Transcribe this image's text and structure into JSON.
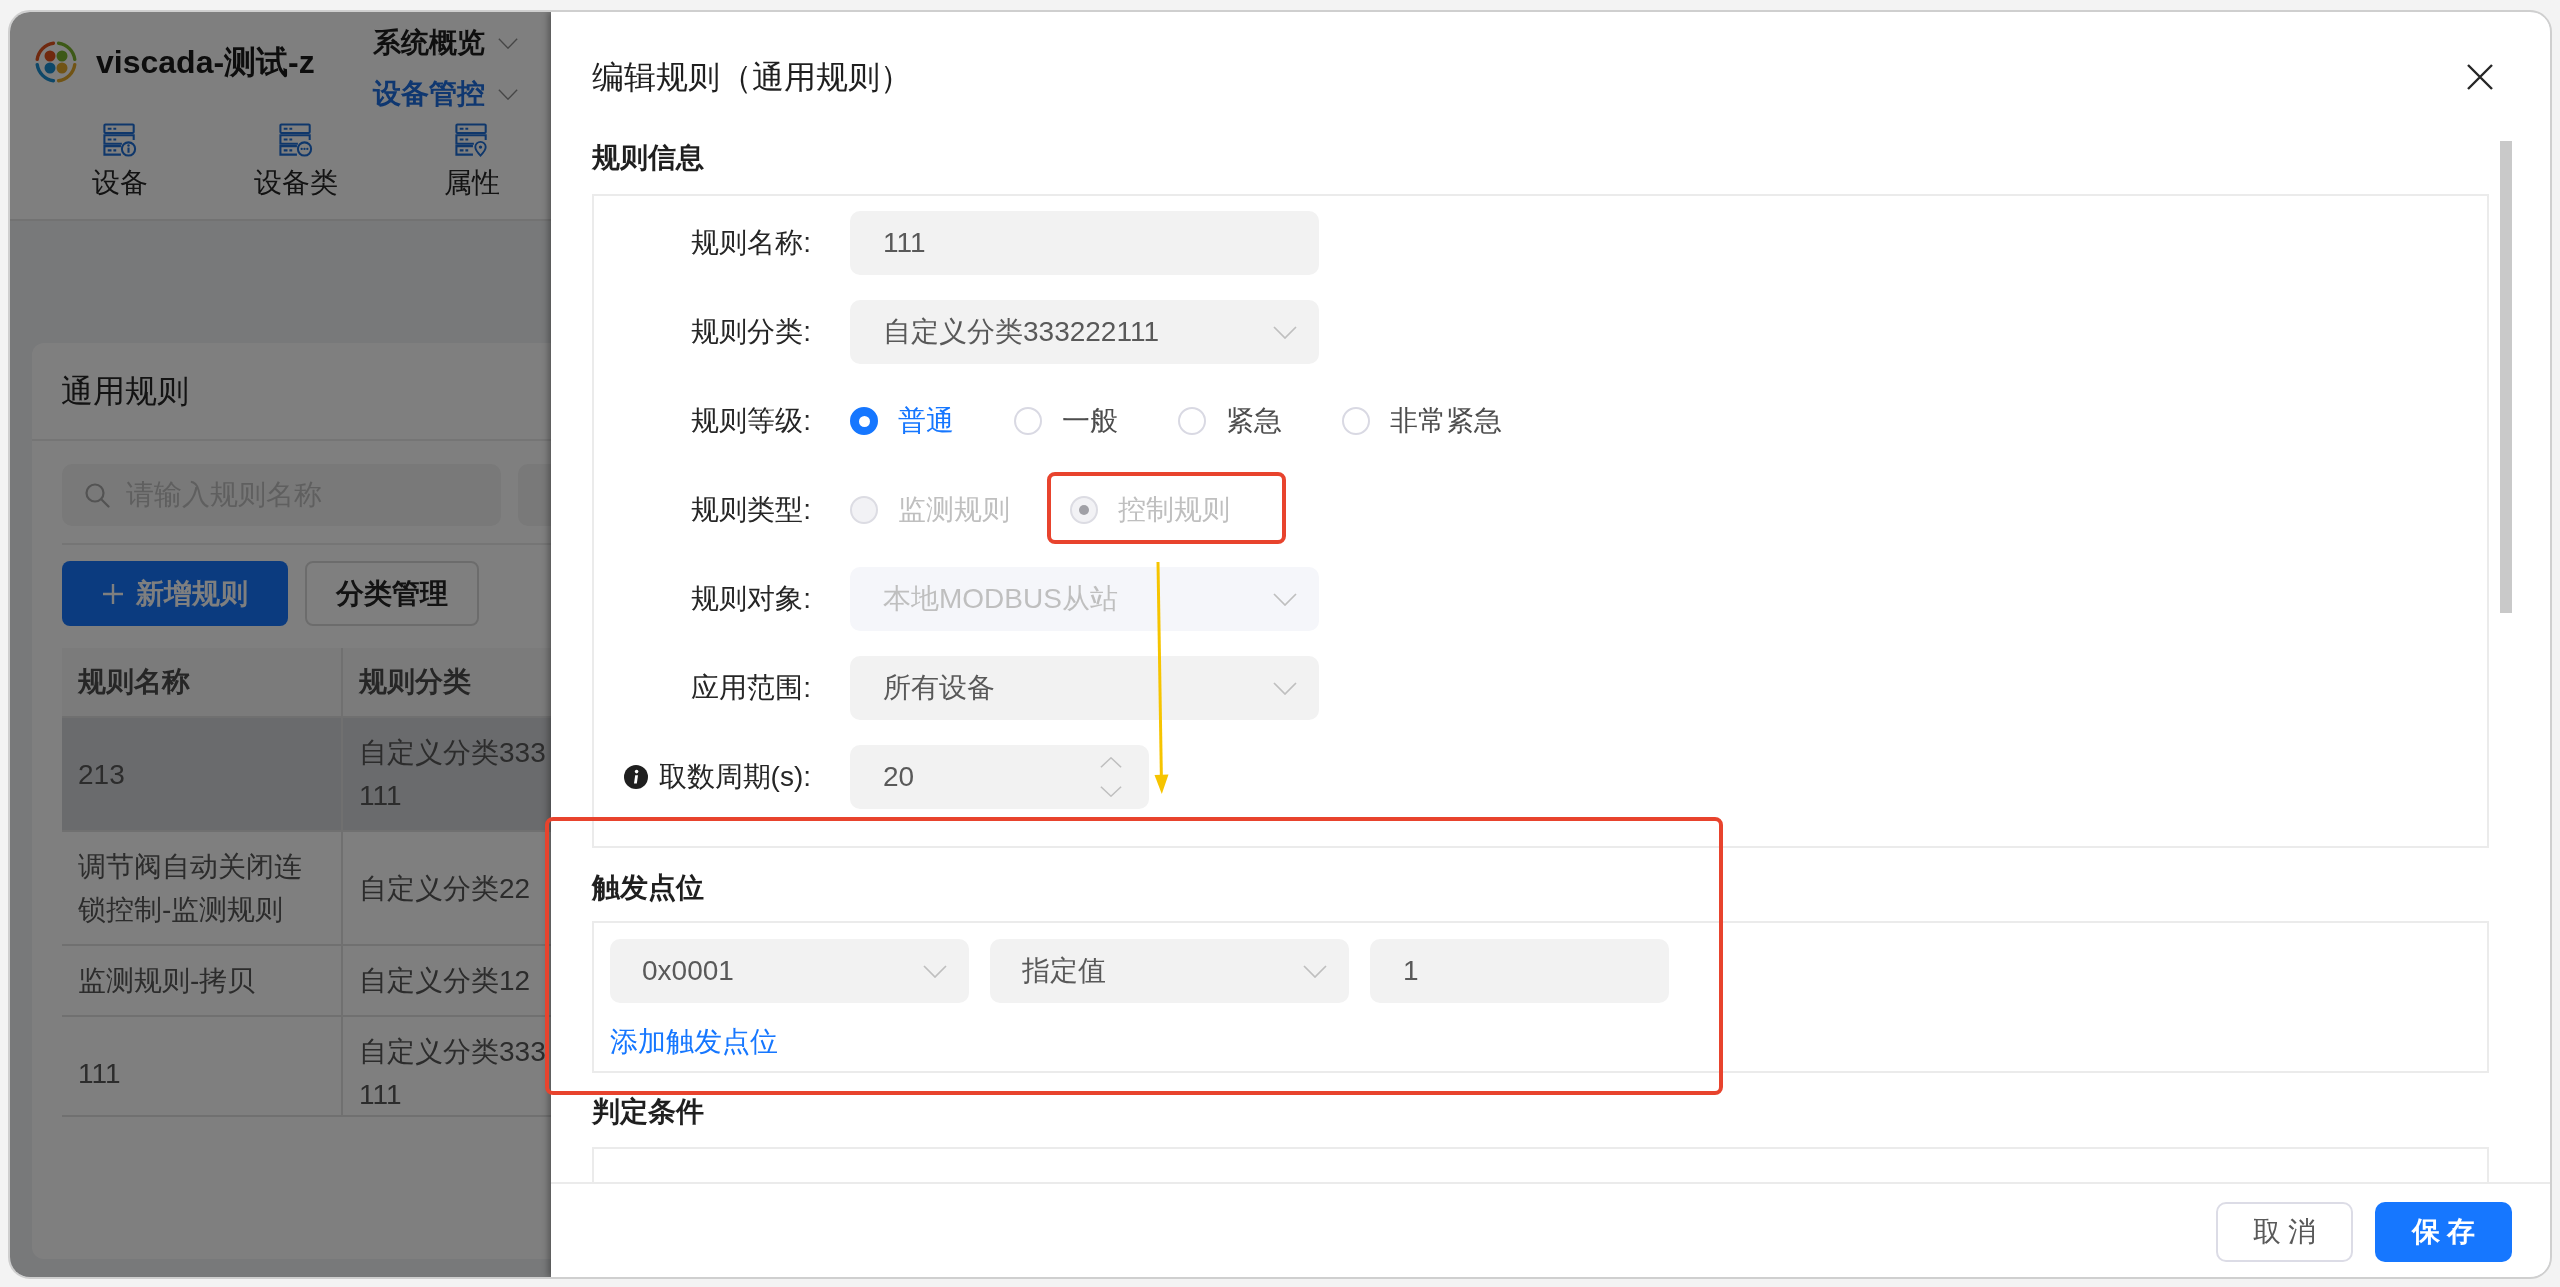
{
  "header": {
    "title": "viscada-测试-z",
    "menus": [
      {
        "label": "系统概览",
        "selected": false
      },
      {
        "label": "设备管控",
        "selected": true
      }
    ],
    "toolbar": [
      {
        "label": "设备",
        "kind": "info"
      },
      {
        "label": "设备类",
        "kind": "more"
      },
      {
        "label": "属性",
        "kind": "pin"
      }
    ]
  },
  "card": {
    "title": "通用规则",
    "filters": [
      {
        "kind": "search",
        "placeholder": "请输入规则名称"
      },
      {
        "kind": "select"
      }
    ],
    "buttons": [
      {
        "label": "新增规则",
        "kind": "add"
      },
      {
        "label": "分类管理",
        "kind": "default"
      }
    ],
    "table": {
      "columns": [
        "规则名称",
        "规则分类"
      ],
      "rows": [
        {
          "selected": true,
          "cells": [
            "213",
            "自定义分类333\n111"
          ]
        },
        {
          "selected": false,
          "cells": [
            "调节阀自动关闭连锁控制-监测规则",
            "自定义分类22"
          ]
        },
        {
          "selected": false,
          "cells": [
            "监测规则-拷贝",
            "自定义分类12"
          ]
        },
        {
          "selected": false,
          "cells": [
            "111",
            "自定义分类333\n111"
          ]
        }
      ]
    }
  },
  "drawer": {
    "title": "编辑规则（通用规则）",
    "sections": [
      {
        "kind": "form",
        "title": "规则信息",
        "fields": [
          {
            "kind": "input",
            "label": "规则名称:",
            "value": "111",
            "disabled": false,
            "tip": false
          },
          {
            "kind": "select",
            "label": "规则分类:",
            "value": "自定义分类333222111",
            "disabled": false,
            "tip": false
          },
          {
            "kind": "radio",
            "label": "规则等级:",
            "disabled": false,
            "tip": false,
            "options": [
              {
                "label": "普通",
                "selected": true
              },
              {
                "label": "一般",
                "selected": false
              },
              {
                "label": "紧急",
                "selected": false
              },
              {
                "label": "非常紧急",
                "selected": false
              }
            ]
          },
          {
            "kind": "radio",
            "label": "规则类型:",
            "disabled": true,
            "tip": false,
            "options": [
              {
                "label": "监测规则",
                "selected": false
              },
              {
                "label": "控制规则",
                "selected": true
              }
            ]
          },
          {
            "kind": "select",
            "label": "规则对象:",
            "value": "本地MODBUS从站",
            "disabled": true,
            "tip": false
          },
          {
            "kind": "select",
            "label": "应用范围:",
            "value": "所有设备",
            "disabled": false,
            "tip": false
          },
          {
            "kind": "number",
            "label": "取数周期(s):",
            "value": "20",
            "disabled": false,
            "tip": true
          }
        ]
      },
      {
        "kind": "trigger",
        "title": "触发点位",
        "fields": [
          {
            "kind": "select",
            "value": "0x0001"
          },
          {
            "kind": "select",
            "value": "指定值"
          },
          {
            "kind": "input",
            "value": "1"
          }
        ],
        "link": "添加触发点位"
      },
      {
        "kind": "conditions",
        "title": "判定条件"
      }
    ],
    "buttons": [
      {
        "label": "取 消",
        "kind": "default"
      },
      {
        "label": "保 存",
        "kind": "primary"
      }
    ]
  },
  "annotations": [
    {
      "kind": "box",
      "color": "#e8432d"
    },
    {
      "kind": "arrow",
      "color": "#f6c400"
    },
    {
      "kind": "box",
      "color": "#e8432d"
    }
  ]
}
